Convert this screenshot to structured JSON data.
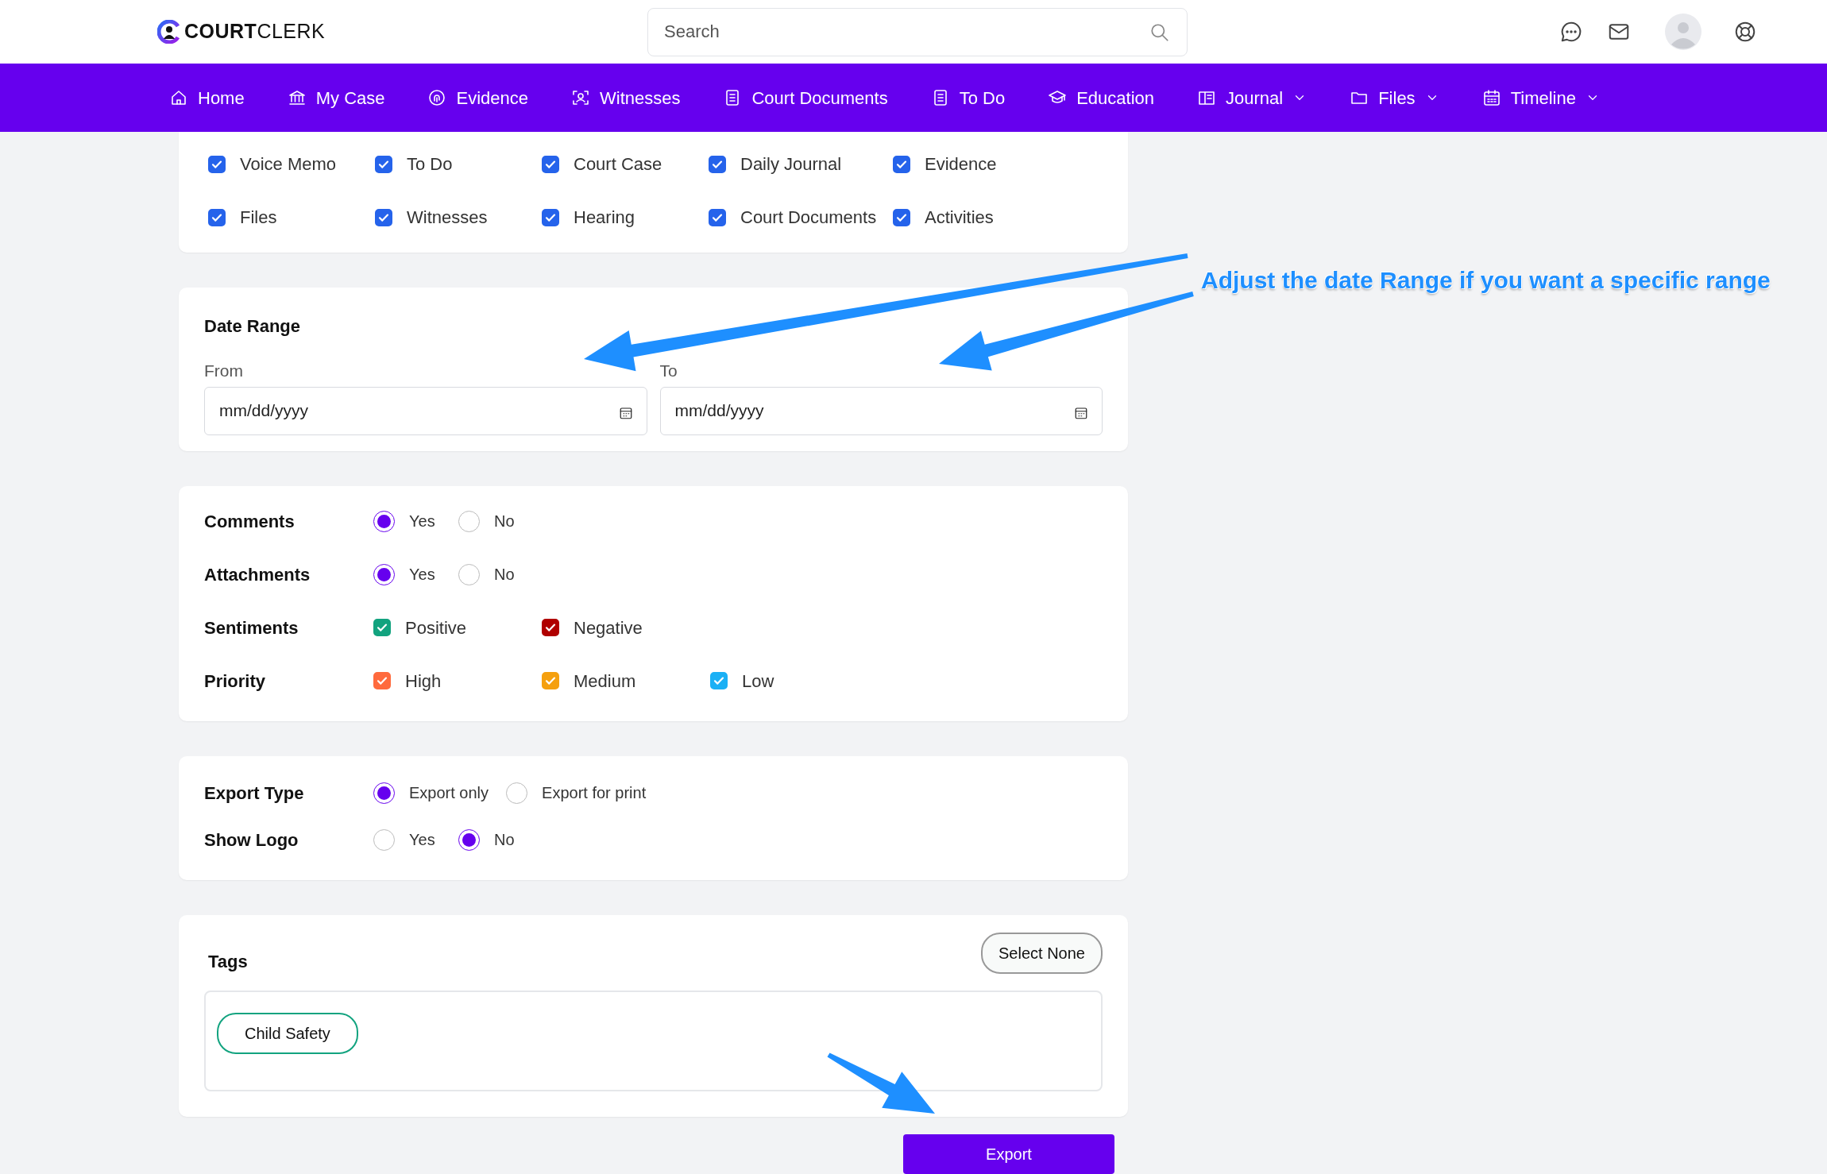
{
  "header": {
    "logo": {
      "bold": "COURT",
      "light": "CLERK"
    },
    "search": {
      "placeholder": "Search"
    }
  },
  "nav": [
    {
      "label": "Home",
      "dropdown": false
    },
    {
      "label": "My Case",
      "dropdown": false
    },
    {
      "label": "Evidence",
      "dropdown": false
    },
    {
      "label": "Witnesses",
      "dropdown": false
    },
    {
      "label": "Court Documents",
      "dropdown": false
    },
    {
      "label": "To Do",
      "dropdown": false
    },
    {
      "label": "Education",
      "dropdown": false
    },
    {
      "label": "Journal",
      "dropdown": true
    },
    {
      "label": "Files",
      "dropdown": true
    },
    {
      "label": "Timeline",
      "dropdown": true
    }
  ],
  "types": [
    {
      "label": "Voice Memo",
      "checked": true
    },
    {
      "label": "To Do",
      "checked": true
    },
    {
      "label": "Court Case",
      "checked": true
    },
    {
      "label": "Daily Journal",
      "checked": true
    },
    {
      "label": "Evidence",
      "checked": true
    },
    {
      "label": "Files",
      "checked": true
    },
    {
      "label": "Witnesses",
      "checked": true
    },
    {
      "label": "Hearing",
      "checked": true
    },
    {
      "label": "Court Documents",
      "checked": true
    },
    {
      "label": "Activities",
      "checked": true
    }
  ],
  "date_range": {
    "title": "Date Range",
    "fields": [
      {
        "label": "From",
        "placeholder": "mm/dd/yyyy"
      },
      {
        "label": "To",
        "placeholder": "mm/dd/yyyy"
      }
    ]
  },
  "filters": [
    {
      "label": "Comments",
      "kind": "radio",
      "options": [
        {
          "label": "Yes",
          "selected": true
        },
        {
          "label": "No",
          "selected": false
        }
      ]
    },
    {
      "label": "Attachments",
      "kind": "radio",
      "options": [
        {
          "label": "Yes",
          "selected": true
        },
        {
          "label": "No",
          "selected": false
        }
      ]
    },
    {
      "label": "Sentiments",
      "kind": "checkbox",
      "options": [
        {
          "label": "Positive",
          "checked": true,
          "color": "#12a37f"
        },
        {
          "label": "Negative",
          "checked": true,
          "color": "#b00000"
        }
      ]
    },
    {
      "label": "Priority",
      "kind": "checkbox",
      "options": [
        {
          "label": "High",
          "checked": true,
          "color": "#ff6a3d"
        },
        {
          "label": "Medium",
          "checked": true,
          "color": "#f5a00f"
        },
        {
          "label": "Low",
          "checked": true,
          "color": "#1ab0f5"
        }
      ]
    }
  ],
  "export_options": [
    {
      "label": "Export Type",
      "kind": "radio",
      "options": [
        {
          "label": "Export only",
          "selected": true
        },
        {
          "label": "Export for print",
          "selected": false
        }
      ]
    },
    {
      "label": "Show Logo",
      "kind": "radio",
      "options": [
        {
          "label": "Yes",
          "selected": false
        },
        {
          "label": "No",
          "selected": true
        }
      ]
    }
  ],
  "tags": {
    "title": "Tags",
    "select_none": "Select None",
    "items": [
      {
        "label": "Child Safety"
      }
    ]
  },
  "export_button": "Export",
  "annotation": {
    "text": "Adjust the date Range if you want a specific range"
  }
}
